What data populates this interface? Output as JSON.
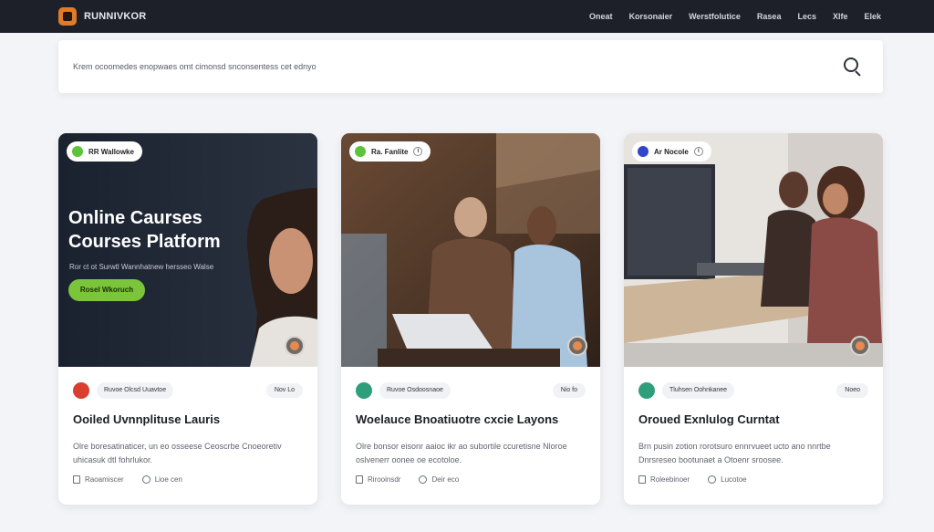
{
  "app": {
    "brand_name": "RUNNIVKOR"
  },
  "nav": {
    "items": [
      {
        "label": "Oneat"
      },
      {
        "label": "Korsonaier"
      },
      {
        "label": "Werstfolutice"
      },
      {
        "label": "Rasea"
      },
      {
        "label": "Lecs"
      },
      {
        "label": "Xlfe"
      },
      {
        "label": "Elek"
      }
    ]
  },
  "search": {
    "placeholder": "Krem ocoomedes enopwaes omt cimonsd snconsentess cet ednyo"
  },
  "cards": [
    {
      "pill_label": "RR Wallowke",
      "hero_title": "Online Caurses Courses Platform",
      "hero_subtitle": "Ror ct ot Surwtl Wannhatnew hersseo Walse",
      "hero_cta": "Rosel Wkoruch",
      "author": "Ruvoe Olcsd Uuavtoe",
      "rating": "Nov Lo",
      "title": "Ooiled Uvnnplituse Lauris",
      "description": "Olre boresatinaticer, un eo osseese Ceoscrbe Cnoeoretiv uhicasuk dtl fohrlukor.",
      "lessons": "Raoamiscer",
      "duration": "Lioe cen",
      "colors": {
        "avatar": "#d93e2f"
      }
    },
    {
      "pill_label": "Ra. Fanlite",
      "author": "Ruvoe Osdoosnaoe",
      "rating": "Nio fo",
      "title": "Woelauce Bnoatiuotre cxcie Layons",
      "description": "Olre bonsor eisonr aaioc ikr ao subortile ccuretisne Nloroe oslvenerr oonee oe ecotoloe.",
      "lessons": "Rirooinsdr",
      "duration": "Deir eco",
      "colors": {
        "avatar": "#2f9e7a"
      }
    },
    {
      "pill_label": "Ar Nocole",
      "author": "Tluhsen Oohnkanee",
      "rating": "Noeo",
      "title": "Oroued Exnlulog Curntat",
      "description": "Brn pusin zotion rorotsuro ennrvueet ucto ano nnrtbe Dnrsreseo bootunaet a Otoenr sroosee.",
      "lessons": "Roleebinoer",
      "duration": "Lucotoe",
      "colors": {
        "avatar": "#2f9e7a"
      }
    }
  ]
}
